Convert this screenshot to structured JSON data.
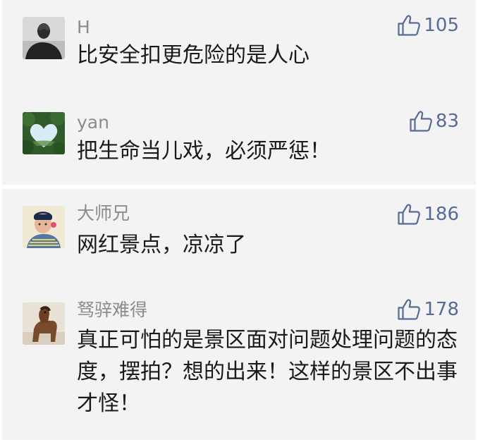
{
  "comments": [
    {
      "name": "H",
      "text": "比安全扣更危险的是人心",
      "likes": "105",
      "avatar_icon": "hooded-figure-avatar"
    },
    {
      "name": "yan",
      "text": "把生命当儿戏，必须严惩！",
      "likes": "83",
      "avatar_icon": "heart-hedge-avatar"
    },
    {
      "name": "大师兄",
      "text": "网红景点，凉凉了",
      "likes": "186",
      "avatar_icon": "cartoon-man-avatar"
    },
    {
      "name": "驽骍难得",
      "text": "真正可怕的是景区面对问题处理问题的态度，摆拍？想的出来！这样的景区不出事才怪！",
      "likes": "178",
      "avatar_icon": "horse-avatar"
    }
  ],
  "colors": {
    "card_bg": "#f3f3f3",
    "name": "#8c8c8c",
    "like_accent": "#576b95",
    "text": "#1a1a1a"
  },
  "like_icon": "thumbs-up-icon"
}
